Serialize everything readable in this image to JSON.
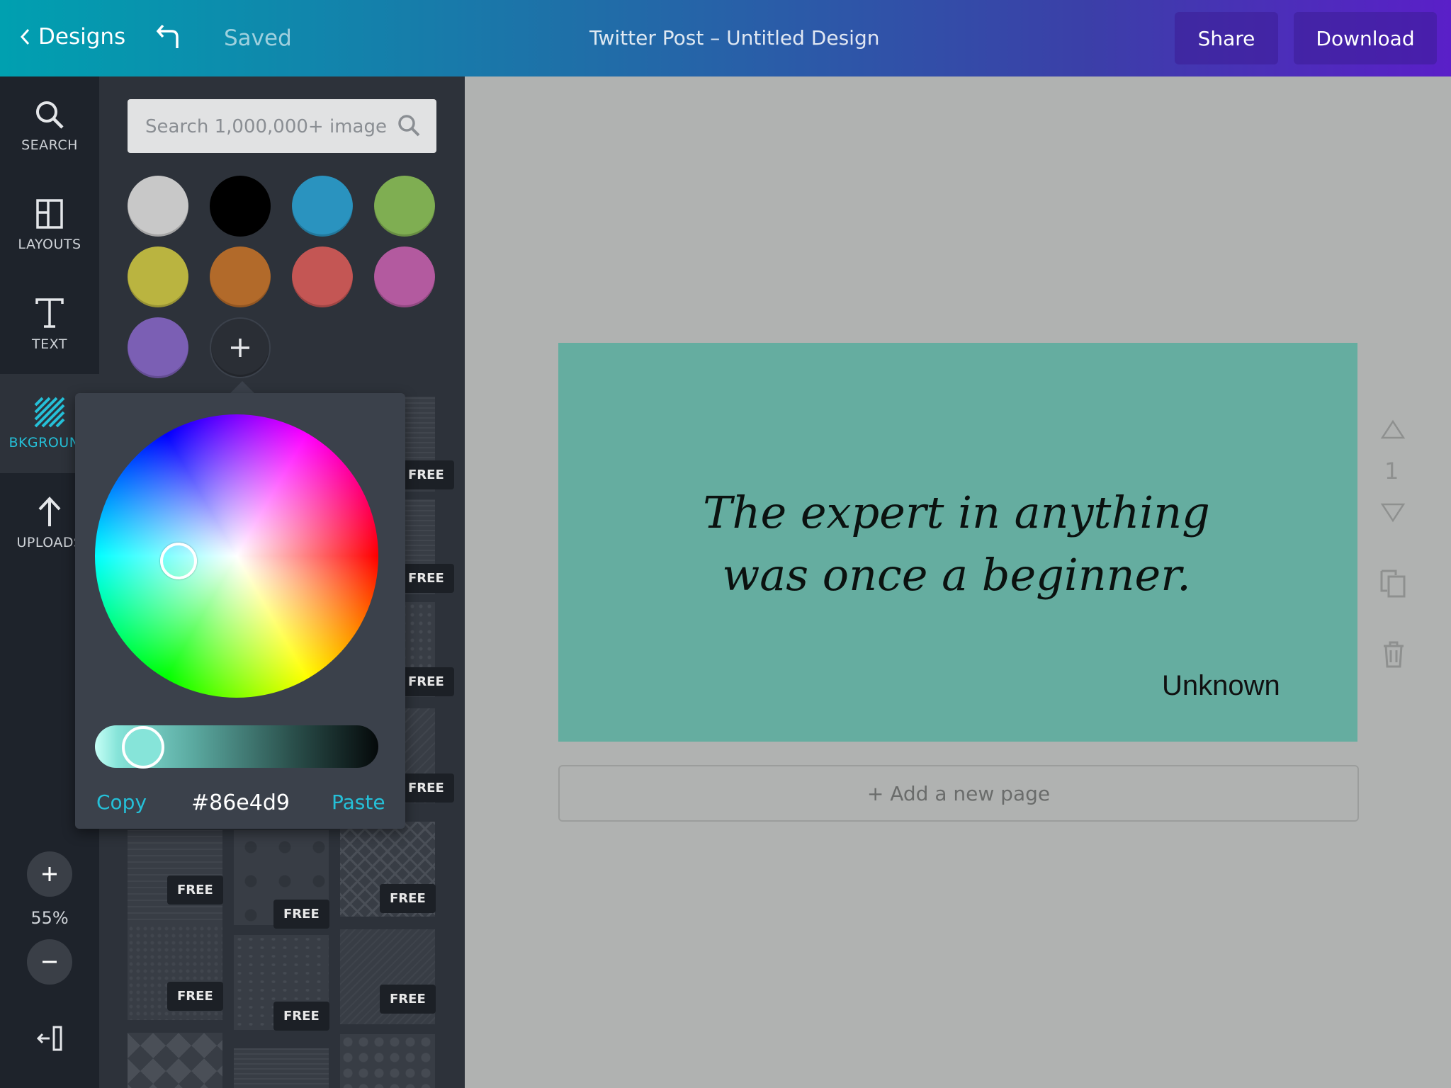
{
  "header": {
    "back_label": "Designs",
    "saved_label": "Saved",
    "title": "Twitter Post – Untitled Design",
    "share_label": "Share",
    "download_label": "Download"
  },
  "rail": {
    "items": [
      {
        "label": "SEARCH",
        "icon": "search-icon"
      },
      {
        "label": "LAYOUTS",
        "icon": "layouts-icon"
      },
      {
        "label": "TEXT",
        "icon": "text-icon"
      },
      {
        "label": "BKGROUND",
        "icon": "background-icon"
      },
      {
        "label": "UPLOADS",
        "icon": "upload-icon"
      }
    ],
    "zoom": "55%"
  },
  "panel": {
    "search_placeholder": "Search 1,000,000+ images",
    "swatches": [
      "#c8c8c8",
      "#000000",
      "#2a93bf",
      "#7fae52",
      "#bab440",
      "#b26a2a",
      "#c45654",
      "#b35a9f",
      "#7b5fb4"
    ],
    "free_label": "FREE"
  },
  "picker": {
    "copy_label": "Copy",
    "paste_label": "Paste",
    "hex": "#86e4d9"
  },
  "canvas": {
    "quote": "The expert in anything was once a beginner.",
    "author": "Unknown",
    "add_page_label": "+ Add a new page",
    "page_number": "1",
    "background_color": "#65ada0"
  },
  "colors": {
    "accent": "#25c0d8"
  }
}
